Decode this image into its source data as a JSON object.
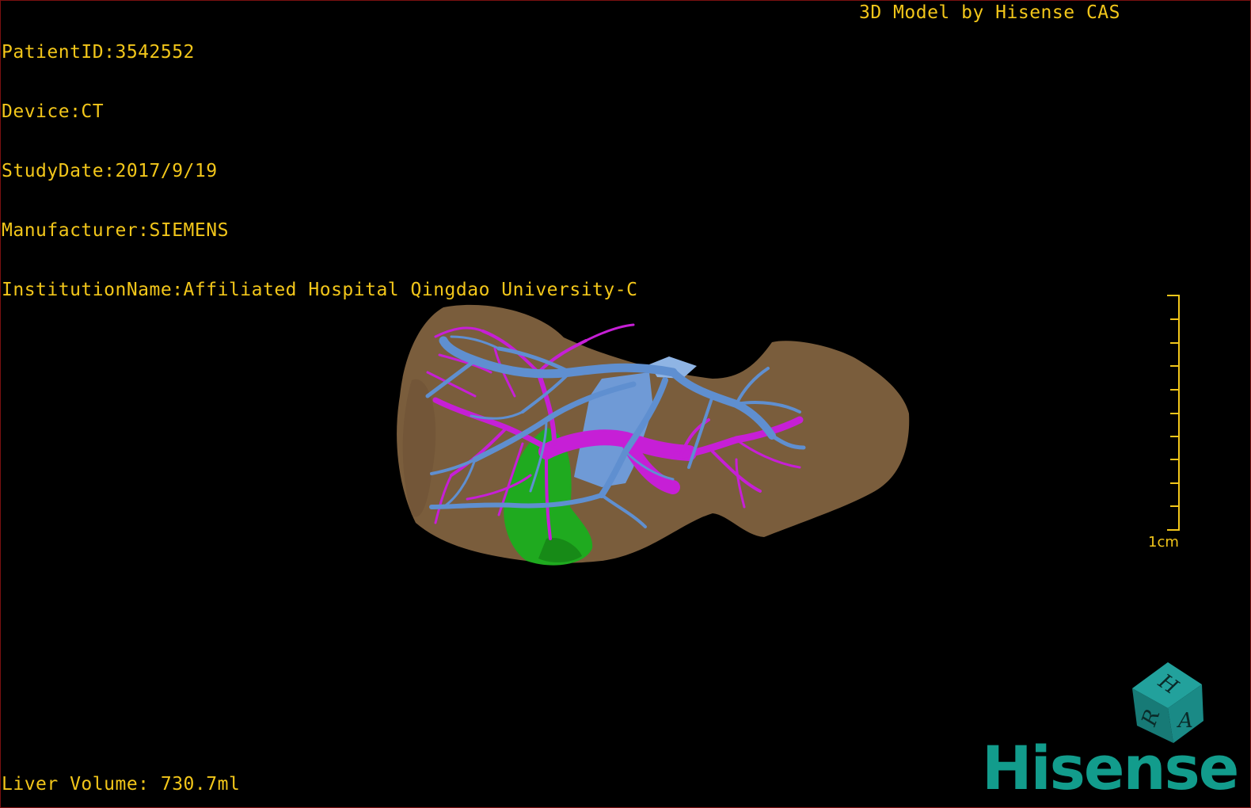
{
  "patient_info": {
    "patient_id": "PatientID:3542552",
    "device": "Device:CT",
    "study_date": "StudyDate:2017/9/19",
    "manufacturer": "Manufacturer:SIEMENS",
    "institution": "InstitutionName:Affiliated Hospital Qingdao University-C"
  },
  "header": {
    "title": "3D Model by Hisense CAS"
  },
  "footer": {
    "liver_volume": "Liver Volume: 730.7ml"
  },
  "scale": {
    "label": "1cm",
    "ticks": 10
  },
  "orientation_cube": {
    "labels": [
      "H",
      "R",
      "A"
    ],
    "color": "#1a8a86"
  },
  "logo": {
    "text": "Hisense",
    "color": "#129c8c"
  },
  "model": {
    "liver_color": "#7a5d3c",
    "hepatic_vein_color": "#5f8fd0",
    "portal_vein_color": "#c61fd6",
    "gallbladder_color": "#1faa1f"
  },
  "accent_text_color": "#f2c61a"
}
